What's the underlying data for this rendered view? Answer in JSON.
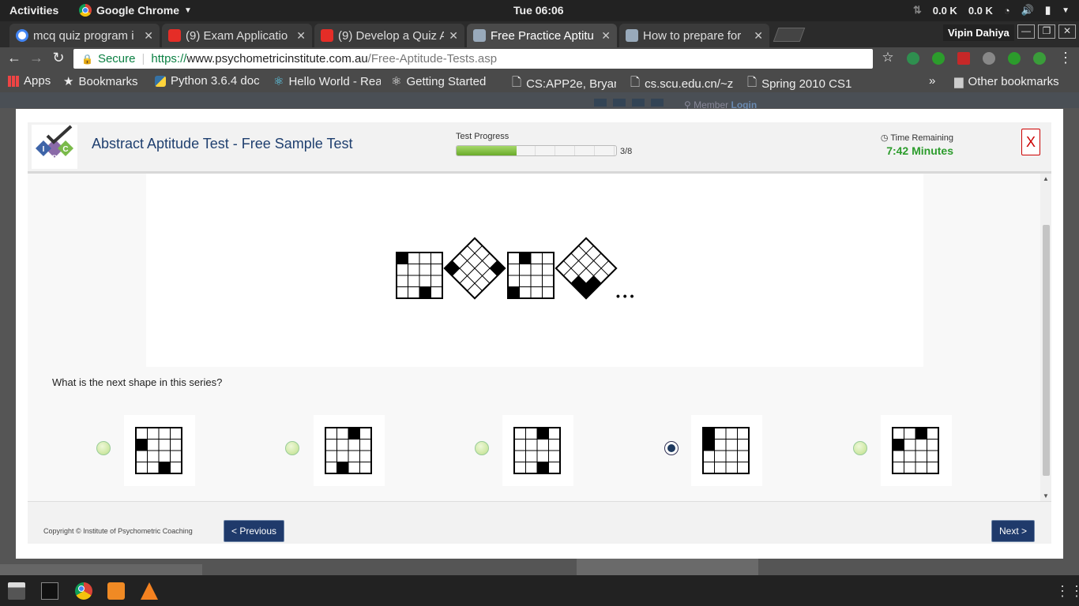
{
  "topbar": {
    "activities": "Activities",
    "app_name": "Google Chrome",
    "clock": "Tue 06:06",
    "net_up": "0.0 K",
    "net_down": "0.0 K"
  },
  "tabs": [
    {
      "title": "mcq quiz program i",
      "favicon": "google-icon"
    },
    {
      "title": "(9) Exam Applicatio",
      "favicon": "youtube-icon"
    },
    {
      "title": "(9) Develop a Quiz A",
      "favicon": "youtube-icon"
    },
    {
      "title": "Free Practice Aptitu",
      "favicon": "ipc-icon"
    },
    {
      "title": "How to prepare for",
      "favicon": "ipc-icon"
    }
  ],
  "profile_name": "Vipin Dahiya",
  "omnibox": {
    "secure_label": "Secure",
    "scheme": "https://",
    "host": "www.psychometricinstitute.com.au",
    "path": "/Free-Aptitude-Tests.asp"
  },
  "bookmarks": [
    "Apps",
    "Bookmarks",
    "Python 3.6.4 doc",
    "Hello World - Rea",
    "Getting Started",
    "CS:APP2e, Bryan",
    "cs.scu.edu.cn/~z",
    "Spring 2010 CS1"
  ],
  "bookmarks_overflow": "»",
  "other_bookmarks": "Other bookmarks",
  "background_page": {
    "member_label": "Member",
    "login_label": "Login"
  },
  "modal": {
    "title": "Abstract Aptitude Test - Free Sample Test",
    "progress_label": "Test Progress",
    "progress_fraction": 0.375,
    "progress_count": "3/8",
    "time_label": "Time Remaining",
    "time_value": "7:42 Minutes",
    "close_label": "X",
    "question": "What is the next shape in this series?",
    "series_ellipsis": "• • •",
    "selected_option": 4,
    "copyright": "Copyright © Institute of Psychometric Coaching",
    "prev_label": "< Previous",
    "next_label": "Next >"
  },
  "colors": {
    "accent": "#1f3a6b",
    "timer": "#2c9c2c",
    "progress_fill": "#7dbb3a",
    "close": "#cc0000"
  }
}
